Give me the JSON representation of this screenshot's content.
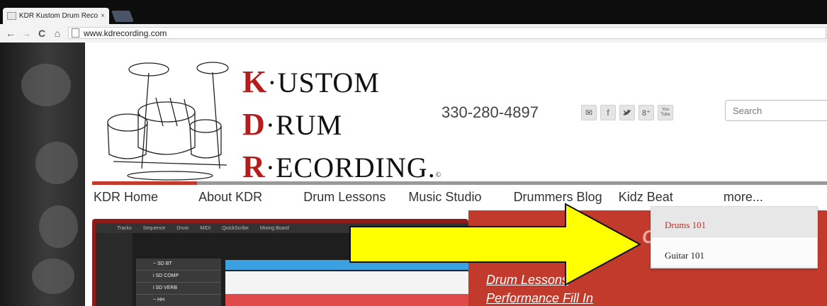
{
  "browser": {
    "tab_title": "KDR Kustom Drum Recorc",
    "close_label": "×",
    "url": "www.kdrecording.com",
    "nav": {
      "back": "←",
      "forward": "→",
      "reload": "C",
      "home": "⌂"
    }
  },
  "site": {
    "logo": {
      "line1_cap": "K",
      "line1_dot": "·",
      "line1_rest": "USTOM",
      "line2_cap": "D",
      "line2_dot": "·",
      "line2_rest": "RUM",
      "line3_cap": "R",
      "line3_dot": "·",
      "line3_rest": "ECORDING.",
      "registered": "©"
    },
    "phone": "330-280-4897",
    "social": [
      {
        "icon": "mail-icon",
        "glyph": "✉"
      },
      {
        "icon": "facebook-icon",
        "glyph": "f"
      },
      {
        "icon": "twitter-icon",
        "glyph": "🐦"
      },
      {
        "icon": "googleplus-icon",
        "glyph": "8⁺"
      },
      {
        "icon": "youtube-icon",
        "glyph": "You Tube"
      }
    ],
    "search_placeholder": "Search",
    "menu": [
      {
        "label": "KDR Home",
        "active": true
      },
      {
        "label": "About KDR",
        "active": false
      },
      {
        "label": "Drum Lessons",
        "active": false
      },
      {
        "label": "Music Studio",
        "active": false
      },
      {
        "label": "Drummers Blog",
        "active": false
      },
      {
        "label": "Kidz Beat",
        "active": false
      },
      {
        "label": "more...",
        "active": false
      }
    ],
    "dropdown": [
      "Drums 101",
      "Guitar 101"
    ],
    "promo_heading": "Cl",
    "promo_links": [
      "Drum Lessons",
      "Performance Fill In"
    ],
    "daw": {
      "tabs": [
        "Tracks",
        "Sequence",
        "Drum",
        "MIDI",
        "QuickScribe",
        "Mixing Board"
      ],
      "tracks": [
        "~ SD BT",
        "i SD COMP",
        "i SD VERB",
        "~ HH"
      ]
    },
    "colors": {
      "accent_red": "#c23a2b",
      "highlight_yellow": "#ffff00",
      "logo_red": "#b71c1c"
    }
  }
}
